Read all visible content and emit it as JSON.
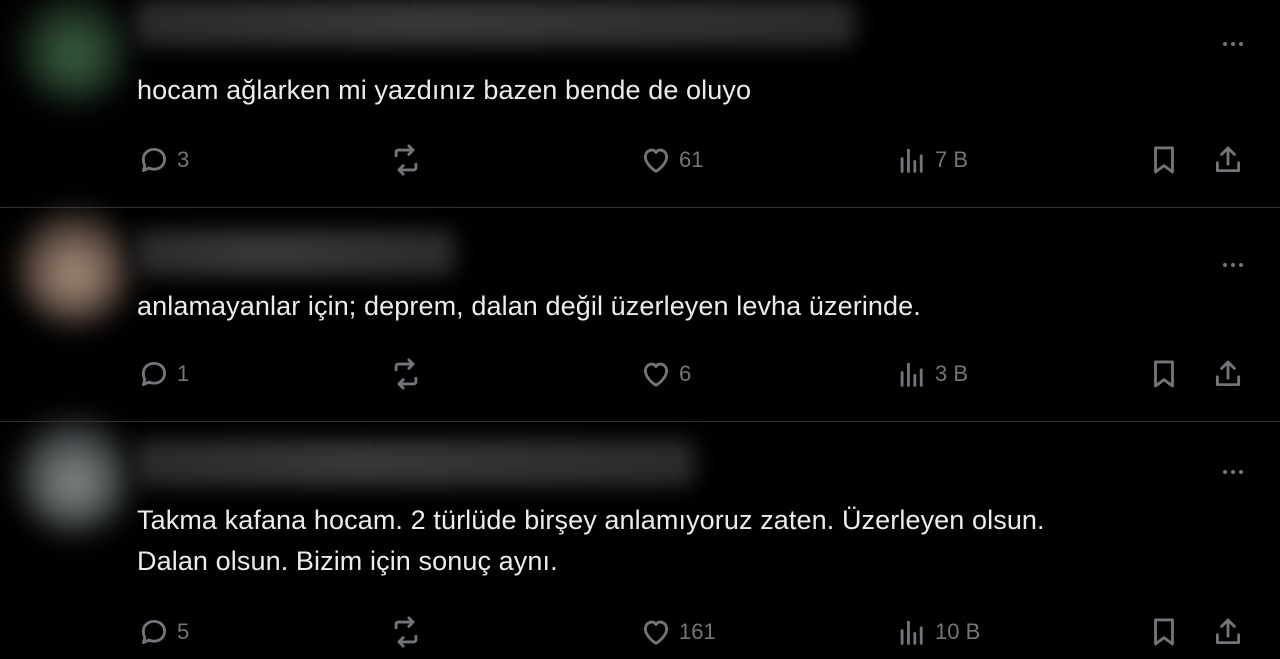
{
  "posts": [
    {
      "text": "hocam ağlarken mi yazdınız bazen bende de oluyo",
      "replies": "3",
      "likes": "61",
      "views": "7 B"
    },
    {
      "text": "anlamayanlar için; deprem, dalan değil üzerleyen levha üzerinde.",
      "replies": "1",
      "likes": "6",
      "views": "3 B"
    },
    {
      "text": "Takma kafana hocam. 2 türlüde birşey anlamıyoruz zaten. Üzerleyen olsun.\nDalan olsun. Bizim için sonuç aynı.",
      "replies": "5",
      "likes": "161",
      "views": "10 B"
    }
  ],
  "icons": {
    "reply": "reply-icon",
    "retweet": "retweet-icon",
    "like": "heart-icon",
    "views": "views-icon",
    "bookmark": "bookmark-icon",
    "share": "share-icon",
    "more": "more-icon"
  },
  "colors": {
    "background": "#000000",
    "text": "#e7e9ea",
    "muted": "#71767b",
    "divider": "#2f3336"
  }
}
